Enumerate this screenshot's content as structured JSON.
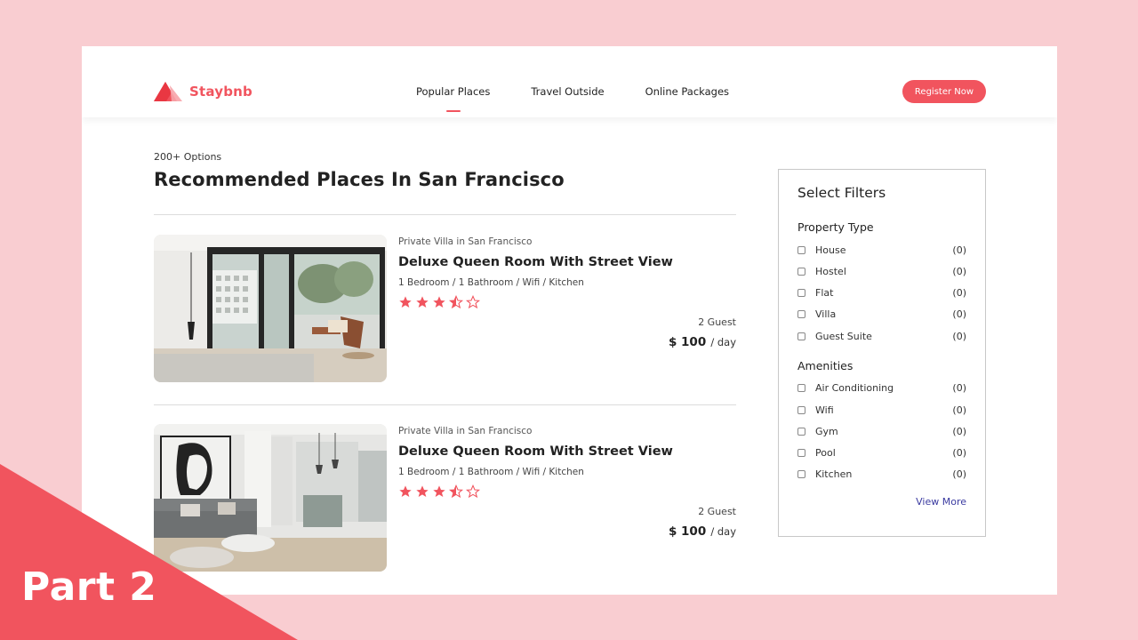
{
  "brand": {
    "name": "Staybnb",
    "color": "#f1545e"
  },
  "nav": {
    "items": [
      {
        "label": "Popular Places",
        "active": true
      },
      {
        "label": "Travel Outside",
        "active": false
      },
      {
        "label": "Online Packages",
        "active": false
      }
    ],
    "register_label": "Register Now"
  },
  "main": {
    "options_count": "200+ Options",
    "title": "Recommended Places In San Francisco"
  },
  "listings": [
    {
      "type": "Private Villa in San Francisco",
      "title": "Deluxe Queen Room With Street View",
      "features": "1 Bedroom / 1 Bathroom / Wifi / Kitchen",
      "rating": 3.5,
      "guests": "2 Guest",
      "price": "$ 100",
      "price_unit": "/ day"
    },
    {
      "type": "Private Villa in San Francisco",
      "title": "Deluxe Queen Room With Street View",
      "features": "1 Bedroom / 1 Bathroom / Wifi / Kitchen",
      "rating": 3.5,
      "guests": "2 Guest",
      "price": "$ 100",
      "price_unit": "/ day"
    }
  ],
  "filters": {
    "title": "Select Filters",
    "groups": [
      {
        "title": "Property Type",
        "options": [
          {
            "label": "House",
            "count": "(0)"
          },
          {
            "label": "Hostel",
            "count": "(0)"
          },
          {
            "label": "Flat",
            "count": "(0)"
          },
          {
            "label": "Villa",
            "count": "(0)"
          },
          {
            "label": "Guest Suite",
            "count": "(0)"
          }
        ]
      },
      {
        "title": "Amenities",
        "options": [
          {
            "label": "Air Conditioning",
            "count": "(0)"
          },
          {
            "label": "Wifi",
            "count": "(0)"
          },
          {
            "label": "Gym",
            "count": "(0)"
          },
          {
            "label": "Pool",
            "count": "(0)"
          },
          {
            "label": "Kitchen",
            "count": "(0)"
          }
        ]
      }
    ],
    "view_more": "View More"
  },
  "corner_badge": {
    "text": "Part 2",
    "color": "#f1545e"
  },
  "icons": {
    "star_full": "star-full-icon",
    "star_half": "star-half-icon",
    "star_empty": "star-empty-icon"
  }
}
